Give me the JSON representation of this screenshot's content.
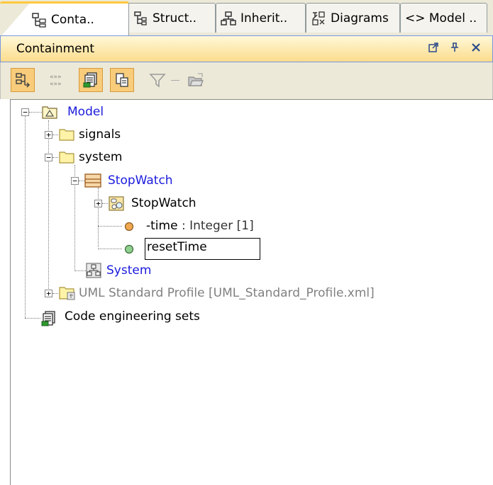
{
  "tabs": [
    {
      "label": "Conta..",
      "icon": "containment-tree-icon",
      "active": true
    },
    {
      "label": "Struct..",
      "icon": "structure-tree-icon",
      "active": false
    },
    {
      "label": "Inherit..",
      "icon": "inheritance-tree-icon",
      "active": false
    },
    {
      "label": "Diagrams",
      "icon": "diagrams-icon",
      "active": false
    },
    {
      "label": "<> Model ..",
      "icon": "",
      "active": false
    }
  ],
  "panel": {
    "title": "Containment",
    "buttons": [
      "undock-icon",
      "pin-icon",
      "close-icon"
    ]
  },
  "toolbar": {
    "buttons": [
      {
        "icon": "group-by-icon",
        "pressed": true
      },
      {
        "icon": "show-stereotypes-icon",
        "pressed": false
      },
      {
        "icon": "show-code-engineering-icon",
        "pressed": true
      },
      {
        "icon": "show-diagrams-icon",
        "pressed": true
      },
      {
        "icon": "filter-icon",
        "pressed": false
      },
      {
        "icon": "open-folder-icon",
        "pressed": false
      }
    ]
  },
  "tree": {
    "model": "Model",
    "signals": "signals",
    "system": "system",
    "stopwatch_class": "StopWatch",
    "stopwatch_statemachine": "StopWatch",
    "attr_time": "-time",
    "attr_time_type": " : Integer [1]",
    "edit_value": "resetTime",
    "system_diagram": "System",
    "uml_profile": "UML Standard Profile [UML_Standard_Profile.xml]",
    "code_sets": "Code engineering sets"
  },
  "colors": {
    "link_blue": "#1b1bde",
    "muted_gray": "#808080",
    "title_gradient_top": "#fff8d8",
    "title_gradient_bottom": "#fbdc8c",
    "active_tab_accent": "#ffc83c"
  }
}
